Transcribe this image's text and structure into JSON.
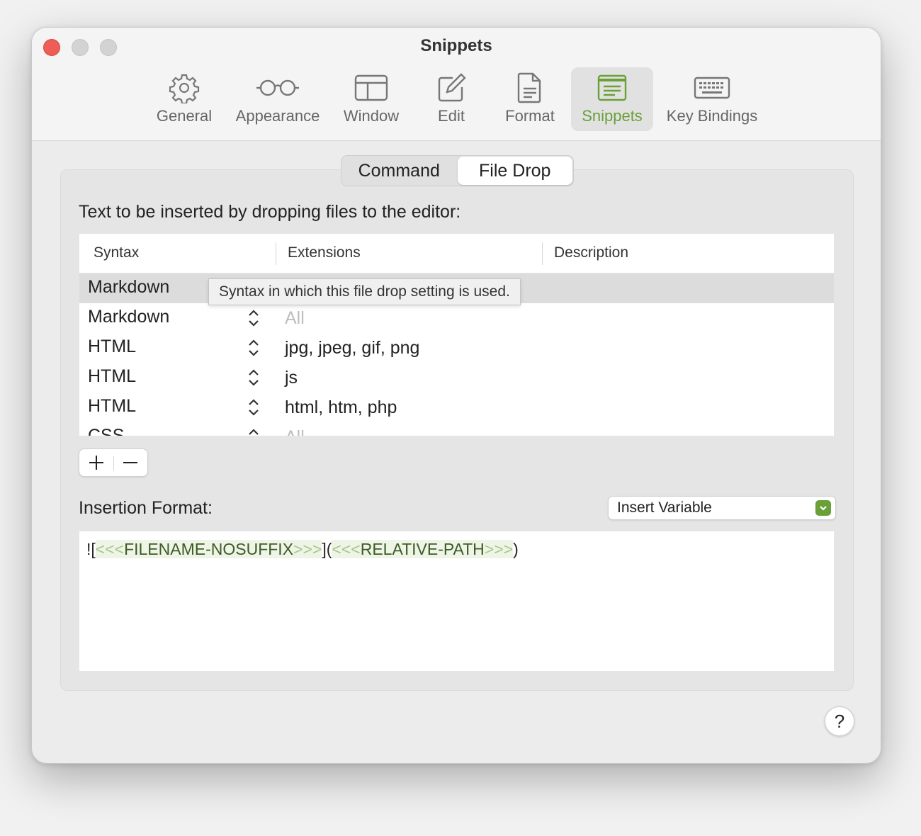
{
  "window": {
    "title": "Snippets"
  },
  "toolbar": {
    "items": [
      {
        "label": "General",
        "icon": "gear-icon"
      },
      {
        "label": "Appearance",
        "icon": "glasses-icon"
      },
      {
        "label": "Window",
        "icon": "window-layout-icon"
      },
      {
        "label": "Edit",
        "icon": "pencil-square-icon"
      },
      {
        "label": "Format",
        "icon": "document-icon"
      },
      {
        "label": "Snippets",
        "icon": "snippets-icon",
        "selected": true
      },
      {
        "label": "Key Bindings",
        "icon": "keyboard-icon"
      }
    ]
  },
  "tabs": [
    {
      "label": "Command",
      "selected": false
    },
    {
      "label": "File Drop",
      "selected": true
    }
  ],
  "description": "Text to be inserted by dropping files to the editor:",
  "table": {
    "columns": [
      "Syntax",
      "Extensions",
      "Description"
    ],
    "rows": [
      {
        "syntax": "Markdown",
        "extensions": "",
        "selected": true
      },
      {
        "syntax": "Markdown",
        "extensions": "All",
        "placeholder": true
      },
      {
        "syntax": "HTML",
        "extensions": "jpg, jpeg, gif, png"
      },
      {
        "syntax": "HTML",
        "extensions": "js"
      },
      {
        "syntax": "HTML",
        "extensions": "html, htm, php"
      },
      {
        "syntax": "CSS",
        "extensions": "All",
        "placeholder": true
      }
    ]
  },
  "tooltip": "Syntax in which this file drop setting is used.",
  "buttons": {
    "add": "+",
    "remove": "−",
    "help": "?"
  },
  "insertion": {
    "label": "Insertion Format:",
    "variable_popup": "Insert Variable",
    "format_parts": {
      "p1": "![",
      "t1_open": "<<<",
      "t1_name": "FILENAME-NOSUFFIX",
      "t1_close": ">>>",
      "p2": "](",
      "t2_open": "<<<",
      "t2_name": "RELATIVE-PATH",
      "t2_close": ">>>",
      "p3": ")"
    }
  },
  "colors": {
    "accent": "#6aa038",
    "close": "#ee5e57"
  }
}
